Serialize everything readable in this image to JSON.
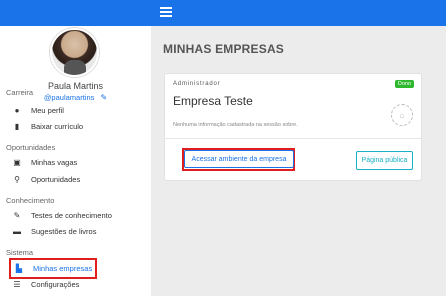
{
  "profile": {
    "name": "Paula Martins",
    "handle": "@paulamartins"
  },
  "sidebar": {
    "sections": [
      {
        "title": "Carreira",
        "items": [
          {
            "label": "Meu perfil",
            "icon": "user-icon"
          },
          {
            "label": "Baixar currículo",
            "icon": "document-icon"
          }
        ]
      },
      {
        "title": "Oportunidades",
        "items": [
          {
            "label": "Minhas vagas",
            "icon": "briefcase-icon"
          },
          {
            "label": "Oportunidades",
            "icon": "search-icon"
          }
        ]
      },
      {
        "title": "Conhecimento",
        "items": [
          {
            "label": "Testes de conhecimento",
            "icon": "user-edit-icon"
          },
          {
            "label": "Sugestões de livros",
            "icon": "book-icon"
          }
        ]
      },
      {
        "title": "Sistema",
        "items": [
          {
            "label": "Minhas empresas",
            "icon": "building-icon",
            "active": true
          },
          {
            "label": "Configurações",
            "icon": "sliders-icon"
          }
        ]
      }
    ]
  },
  "main": {
    "title": "MINHAS EMPRESAS",
    "card": {
      "role": "Administrador",
      "badge": "Dono",
      "company": "Empresa Teste",
      "info": "Nenhuma informação cadastrada na sessão sobre.",
      "access_button": "Acessar ambiente da empresa",
      "public_button": "Página pública"
    }
  },
  "colors": {
    "topbar": "#1a73e8",
    "accent": "#1a73e8",
    "badge": "#2eb82e",
    "public_button": "#19b0c8",
    "highlight": "#e01e1e"
  }
}
